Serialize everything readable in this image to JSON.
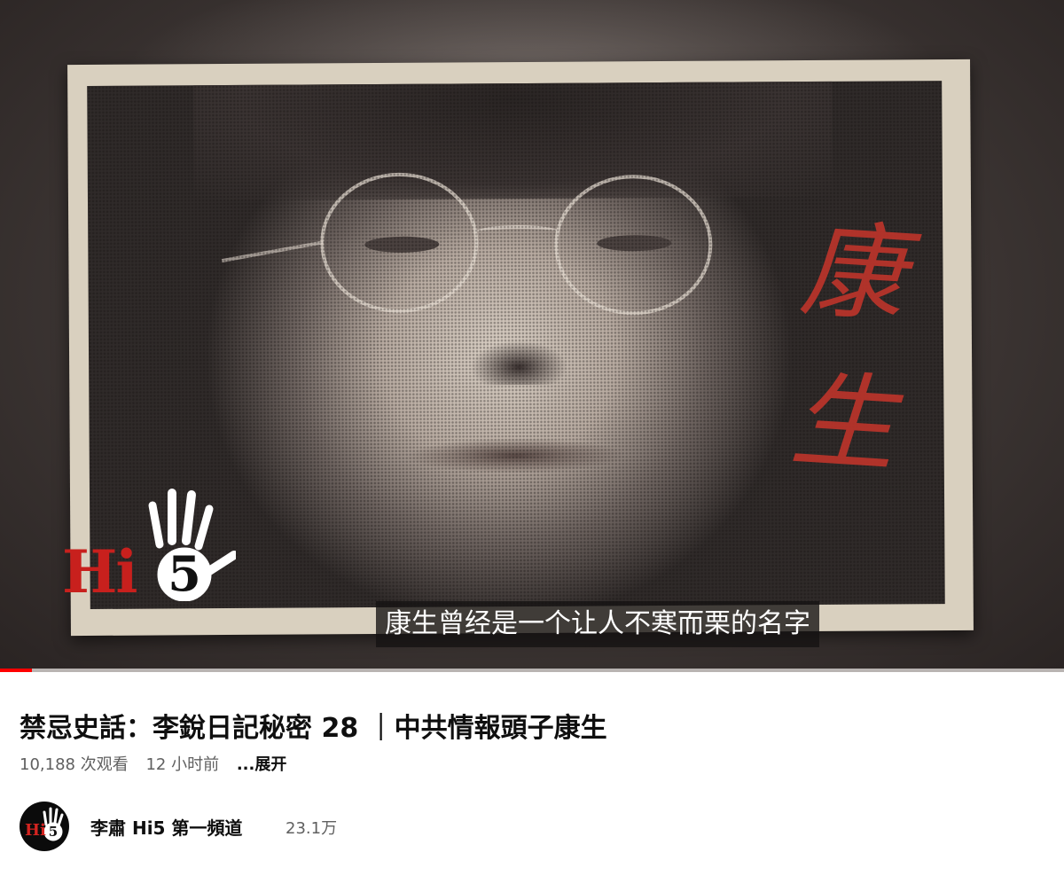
{
  "video": {
    "subtitle": "康生曾经是一个让人不寒而栗的名字",
    "calligraphy": [
      "康",
      "生"
    ],
    "watermark_text": "Hi",
    "watermark_number": "5",
    "progress_fraction": 0.03,
    "accent_color": "#ff0000"
  },
  "info": {
    "title": "禁忌史話：李銳日記秘密 28 ｜中共情報頭子康生",
    "views": "10,188 次观看",
    "age": "12 小时前",
    "more": "...展开"
  },
  "channel": {
    "name": "李肅 Hi5 第一頻道",
    "subscribers": "23.1万",
    "avatar_text": "Hi",
    "avatar_number": "5"
  }
}
